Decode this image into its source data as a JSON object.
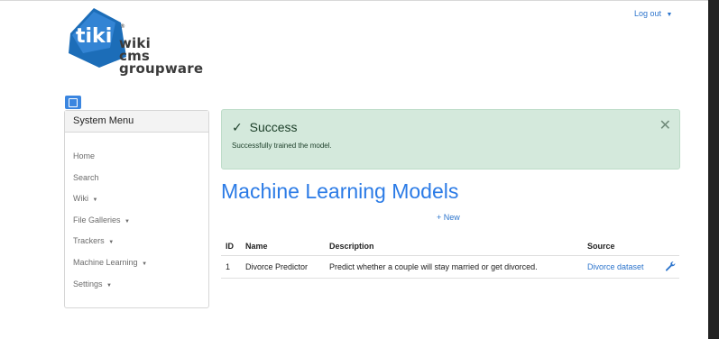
{
  "logo": {
    "mark_text": "tiki",
    "registered": "®",
    "lines": [
      "wiki",
      "cms",
      "groupware"
    ]
  },
  "header": {
    "logout_label": "Log out",
    "logout_caret": "▼"
  },
  "sidebar": {
    "title": "System Menu",
    "items": [
      {
        "label": "Home",
        "caret": ""
      },
      {
        "label": "Search",
        "caret": ""
      },
      {
        "label": "Wiki",
        "caret": "▼"
      },
      {
        "label": "File Galleries",
        "caret": "▼"
      },
      {
        "label": "Trackers",
        "caret": "▼"
      },
      {
        "label": "Machine Learning",
        "caret": "▼"
      },
      {
        "label": "Settings",
        "caret": "▼"
      }
    ]
  },
  "alert": {
    "check": "✓",
    "title": "Success",
    "message": "Successfully trained the model.",
    "close": "✕"
  },
  "main": {
    "title": "Machine Learning Models",
    "new_label": "+ New"
  },
  "table": {
    "headers": {
      "id": "ID",
      "name": "Name",
      "description": "Description",
      "source": "Source"
    },
    "rows": [
      {
        "id": "1",
        "name": "Divorce Predictor",
        "description": "Predict whether a couple will stay married or get divorced.",
        "source": "Divorce dataset"
      }
    ]
  },
  "colors": {
    "accent": "#2b7be6",
    "success_bg": "#d4e9dc",
    "logo_blue": "#1c6db8"
  }
}
